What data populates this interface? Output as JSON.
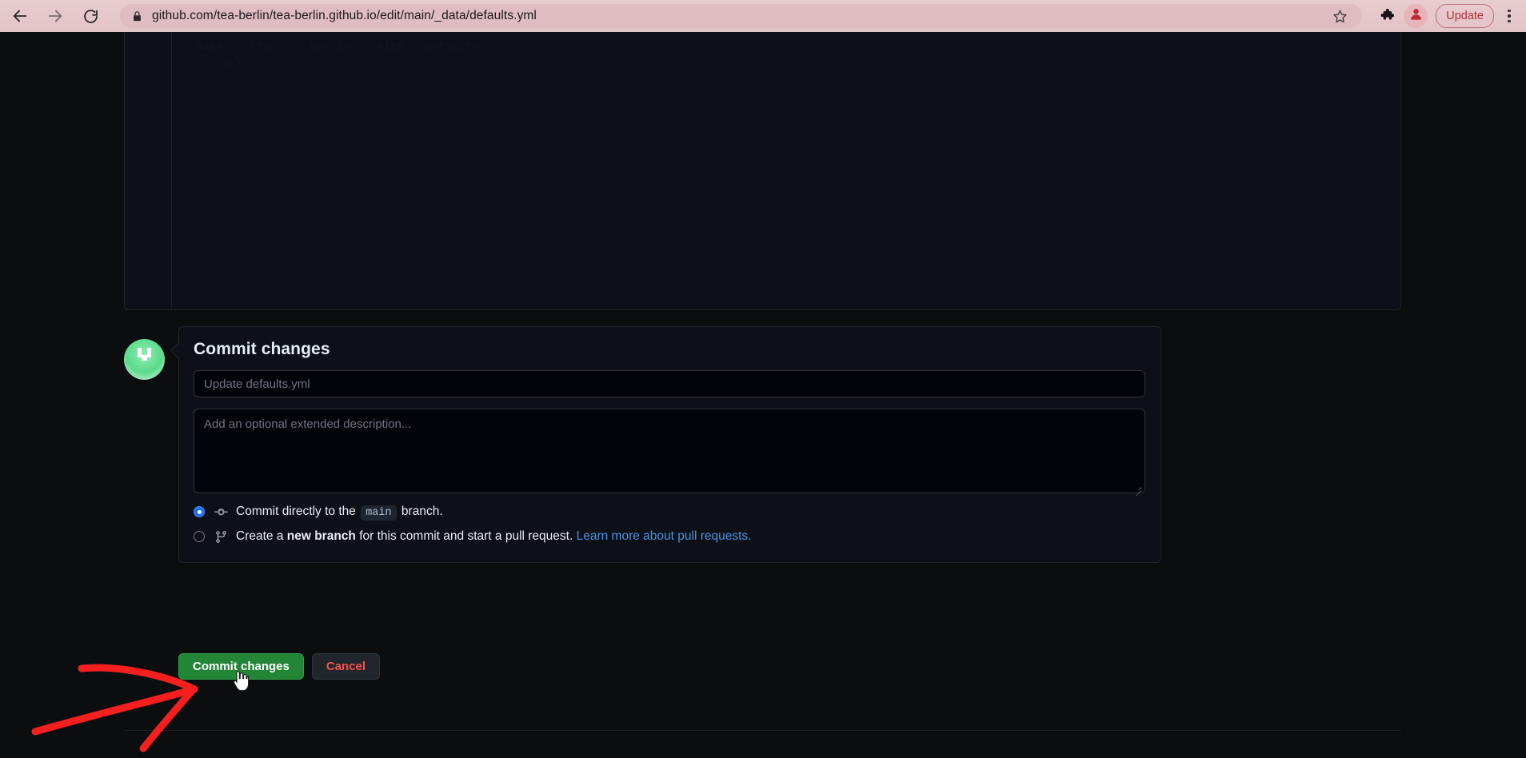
{
  "browser": {
    "back_icon": "back-arrow-icon",
    "forward_icon": "forward-arrow-icon",
    "reload_icon": "reload-icon",
    "lock_icon": "lock-icon",
    "url": "github.com/tea-berlin/tea-berlin.github.io/edit/main/_data/defaults.yml",
    "bookmark_icon": "star-icon",
    "extensions_icon": "puzzle-piece-icon",
    "profile_icon": "profile-avatar-icon",
    "update_label": "Update",
    "menu_icon": "kebab-menu-icon",
    "chrome_bg": "#e3c5ca",
    "update_color": "#b3303a"
  },
  "editor": {
    "ghost_code": "  name:   \"tea\"    berlin    site   defaults\n      url"
  },
  "commit": {
    "avatar_name": "user-avatar",
    "title": "Commit changes",
    "message_placeholder": "Update defaults.yml",
    "message_value": "",
    "description_placeholder": "Add an optional extended description...",
    "description_value": "",
    "options": [
      {
        "selected": true,
        "icon": "git-commit-icon",
        "prefix": "Commit directly to the",
        "branch": "main",
        "suffix": "branch.",
        "link": ""
      },
      {
        "selected": false,
        "icon": "git-branch-icon",
        "prefix": "Create a",
        "bold": "new branch",
        "suffix": "for this commit and start a pull request.",
        "link": "Learn more about pull requests."
      }
    ],
    "submit_label": "Commit changes",
    "cancel_label": "Cancel",
    "submit_color": "#238636",
    "cancel_color": "#f85149",
    "radio_selected_color": "#1f6feb",
    "link_color": "#4a91e6"
  },
  "annotation": {
    "arrow_name": "red-arrow-annotation",
    "arrow_color": "#f51f1f",
    "cursor": "hand-cursor"
  }
}
